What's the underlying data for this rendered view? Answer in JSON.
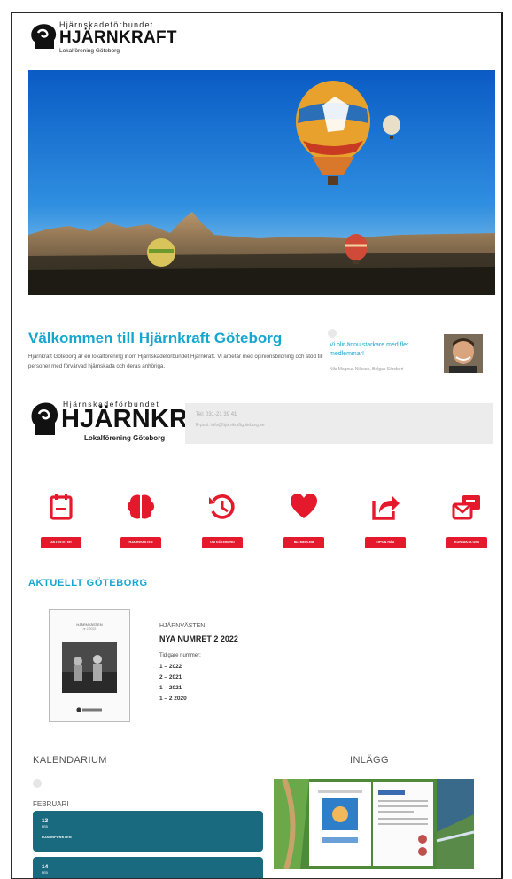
{
  "header": {
    "logo_org": "Hjärnskadeförbundet",
    "logo_brand": "HJÄRNKRAFT",
    "logo_sub": "Lokalförening Göteborg"
  },
  "welcome": {
    "title": "Välkommen till Hjärnkraft Göteborg",
    "text": "Hjärnkraft Göteborg är en lokalförening inom Hjärnskadeförbundet Hjärnkraft. Vi arbetar med opinionsbildning och stöd till personer med förvärvad hjärnskada och deras anhöriga.",
    "member_link": "Vi blir ännu starkare med fler medlemmar!",
    "member_caption": "Nils Magnus Nilsson, Belgas Sörsberi"
  },
  "logo_mid": {
    "org": "Hjärnskadeförbundet",
    "brand": "HJÄRNKRAFT",
    "sub": "Lokalförening Göteborg"
  },
  "contact": {
    "line1": "Tel: 031-21 39 41",
    "line2": "E-post: info@hjarnkraftgoteborg.se"
  },
  "quicklinks": [
    {
      "icon": "calendar-icon",
      "label": "AKTIVITETER"
    },
    {
      "icon": "brain-icon",
      "label": "HJÄRNVÄSTEN"
    },
    {
      "icon": "history-icon",
      "label": "OM GÖTEBORG"
    },
    {
      "icon": "heart-icon",
      "label": "BLI MEDLEM"
    },
    {
      "icon": "share-icon",
      "label": "TIPS & RÅD"
    },
    {
      "icon": "contact-icon",
      "label": "KONTAKTA OSS"
    }
  ],
  "accent": "#e5192c",
  "brand_blue": "#17a6cf",
  "aktuellt": {
    "title": "AKTUELLT GÖTEBORG",
    "cover_title": "HJÄRNVÄSTEN",
    "cover_sub": "nr 2 2022",
    "label": "HJÄRNVÄSTEN",
    "number": "NYA NUMRET 2 2022",
    "previous_label": "Tidigare nummer:",
    "previous": [
      "1 – 2022",
      "2 – 2021",
      "1 – 2021",
      "1 – 2 2020"
    ]
  },
  "kalendarium": {
    "title": "KALENDARIUM",
    "month": "FEBRUARI",
    "events": [
      {
        "day": "13",
        "month": "FEB",
        "name": "HJÄRNPUNKTEN"
      },
      {
        "day": "14",
        "month": "FEB",
        "name": ""
      }
    ]
  },
  "inlagg": {
    "title": "INLÄGG"
  }
}
